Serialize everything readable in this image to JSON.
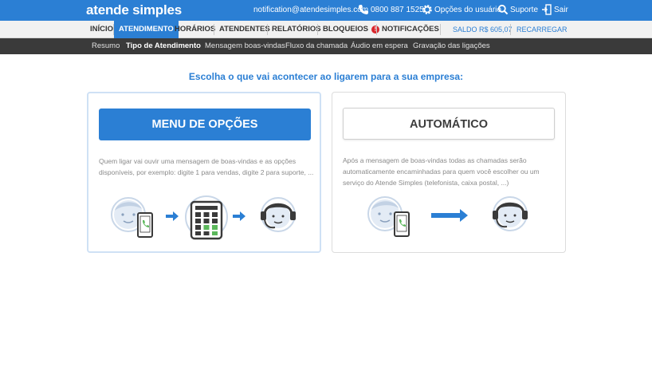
{
  "topbar": {
    "logo": "atende simples",
    "email": "notification@atendesimples.com",
    "phone": "0800 887 1525",
    "options_label": "Opções do usuário",
    "support_label": "Suporte",
    "logout_label": "Sair",
    "icons": [
      "phone-icon",
      "gear-icon",
      "search-icon",
      "logout-icon"
    ]
  },
  "mainnav": {
    "items": [
      {
        "label": "INÍCIO"
      },
      {
        "label": "ATENDIMENTO",
        "active": true
      },
      {
        "label": "HORÁRIOS"
      },
      {
        "label": "ATENDENTES"
      },
      {
        "label": "RELATÓRIOS"
      },
      {
        "label": "BLOQUEIOS",
        "badge": "!"
      },
      {
        "label": "NOTIFICAÇÕES"
      }
    ],
    "balance": "SALDO R$ 605,07",
    "recharge": "RECARREGAR"
  },
  "subnav": {
    "items": [
      {
        "label": "Resumo"
      },
      {
        "label": "Tipo de Atendimento",
        "active": true
      },
      {
        "label": "Mensagem boas-vindas"
      },
      {
        "label": "Fluxo da chamada"
      },
      {
        "label": "Áudio em espera"
      },
      {
        "label": "Gravação das ligações"
      }
    ]
  },
  "headline": "Escolha o que vai acontecer ao ligarem para a sua empresa:",
  "cards": [
    {
      "title": "MENU DE OPÇÕES",
      "description": "Quem ligar vai ouvir uma mensagem de boas-vindas e as opções disponíveis, por exemplo: digite 1 para vendas, digite 2 para suporte, ...",
      "selected": true
    },
    {
      "title": "AUTOMÁTICO",
      "description": "Após a mensagem de boas-vindas todas as chamadas serão automaticamente encaminhadas para quem você escolher ou um serviço do Atende Simples (telefonista, caixa postal, ...)",
      "selected": false
    }
  ],
  "colors": {
    "brand": "#2b7fd4",
    "subnav": "#3a3a3a",
    "badge": "#d9262c",
    "keypad_green": "#5cb85c"
  }
}
